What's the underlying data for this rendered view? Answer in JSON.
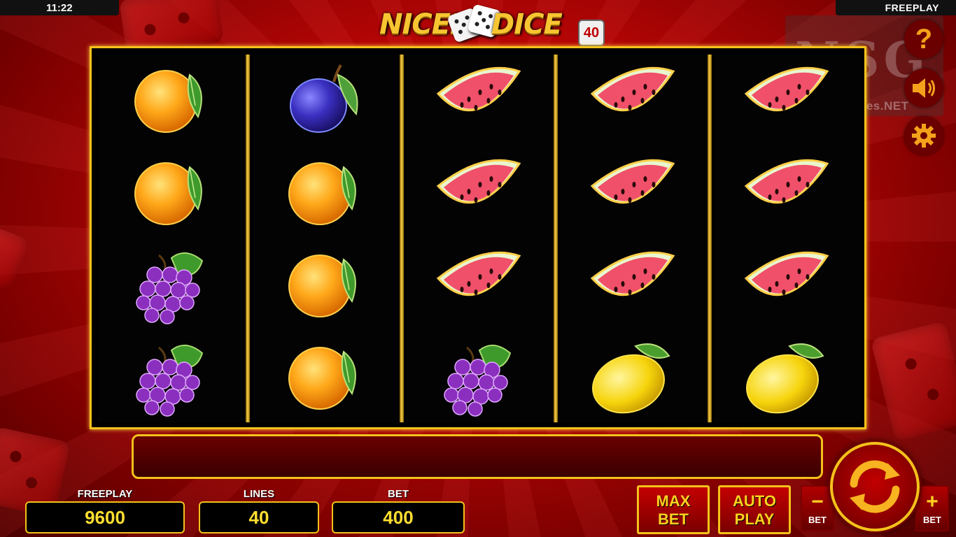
{
  "status_bar": {
    "time": "11:22",
    "mode": "FREEPLAY"
  },
  "logo": {
    "word1": "NICER",
    "word2": "DICE",
    "badge": "40"
  },
  "watermark": {
    "text": "NewSlotGames.NET",
    "logo": "NSG"
  },
  "reels": [
    [
      "orange",
      "orange",
      "grapes",
      "grapes"
    ],
    [
      "plum",
      "orange",
      "orange",
      "orange"
    ],
    [
      "watermelon",
      "watermelon",
      "watermelon",
      "grapes"
    ],
    [
      "watermelon",
      "watermelon",
      "watermelon",
      "lemon"
    ],
    [
      "watermelon",
      "watermelon",
      "watermelon",
      "lemon"
    ]
  ],
  "message": "",
  "freeplay": {
    "label": "FREEPLAY",
    "value": "9600"
  },
  "lines": {
    "label": "LINES",
    "value": "40"
  },
  "bet": {
    "label": "BET",
    "value": "400"
  },
  "buttons": {
    "max_bet": {
      "line1": "MAX",
      "line2": "BET"
    },
    "auto_play": {
      "line1": "AUTO",
      "line2": "PLAY"
    },
    "bet_minus": {
      "symbol": "−",
      "label": "BET"
    },
    "bet_plus": {
      "symbol": "+",
      "label": "BET"
    }
  },
  "side_icons": [
    "help-icon",
    "sound-icon",
    "settings-icon"
  ],
  "colors": {
    "gold": "#f4c21b",
    "red": "#c40000",
    "value_yellow": "#ffde2f"
  }
}
